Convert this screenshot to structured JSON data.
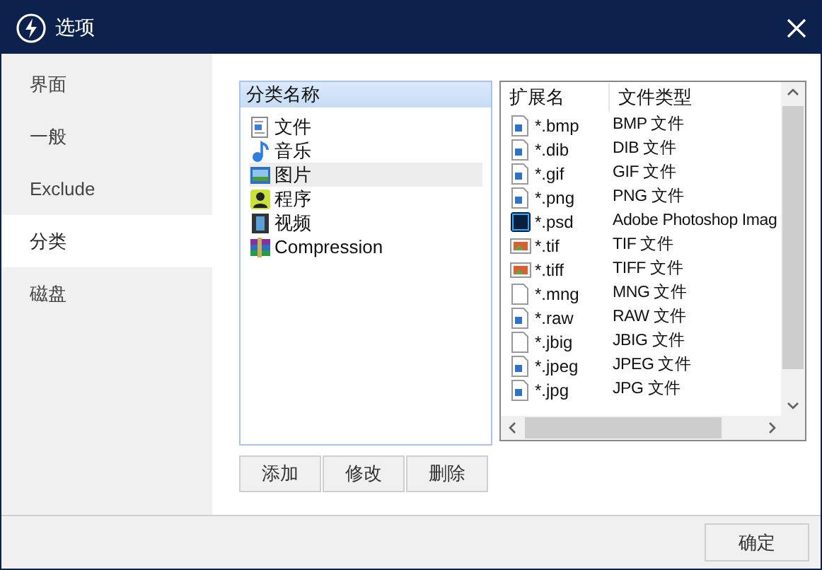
{
  "window": {
    "title": "选项"
  },
  "sidebar": {
    "items": [
      {
        "label": "界面",
        "selected": false
      },
      {
        "label": "一般",
        "selected": false
      },
      {
        "label": "Exclude",
        "selected": false
      },
      {
        "label": "分类",
        "selected": true
      },
      {
        "label": "磁盘",
        "selected": false
      }
    ]
  },
  "categories": {
    "header": "分类名称",
    "items": [
      {
        "label": "文件",
        "kind": "document",
        "selected": false
      },
      {
        "label": "音乐",
        "kind": "music",
        "selected": false
      },
      {
        "label": "图片",
        "kind": "picture",
        "selected": true
      },
      {
        "label": "程序",
        "kind": "program",
        "selected": false
      },
      {
        "label": "视频",
        "kind": "video",
        "selected": false
      },
      {
        "label": "Compression",
        "kind": "archive",
        "selected": false
      }
    ]
  },
  "extensions": {
    "columns": [
      "扩展名",
      "文件类型"
    ],
    "rows": [
      {
        "ext": "*.bmp",
        "type": "BMP 文件",
        "kind": "image"
      },
      {
        "ext": "*.dib",
        "type": "DIB 文件",
        "kind": "image"
      },
      {
        "ext": "*.gif",
        "type": "GIF 文件",
        "kind": "image"
      },
      {
        "ext": "*.png",
        "type": "PNG 文件",
        "kind": "image"
      },
      {
        "ext": "*.psd",
        "type": "Adobe Photoshop Imag",
        "kind": "psd"
      },
      {
        "ext": "*.tif",
        "type": "TIF 文件",
        "kind": "photo"
      },
      {
        "ext": "*.tiff",
        "type": "TIFF 文件",
        "kind": "photo"
      },
      {
        "ext": "*.mng",
        "type": "MNG 文件",
        "kind": "blank"
      },
      {
        "ext": "*.raw",
        "type": "RAW 文件",
        "kind": "image"
      },
      {
        "ext": "*.jbig",
        "type": "JBIG 文件",
        "kind": "blank"
      },
      {
        "ext": "*.jpeg",
        "type": "JPEG 文件",
        "kind": "image"
      },
      {
        "ext": "*.jpg",
        "type": "JPG 文件",
        "kind": "image"
      }
    ]
  },
  "buttons": [
    "添加",
    "修改",
    "删除"
  ],
  "footer": {
    "ok": "确定"
  }
}
